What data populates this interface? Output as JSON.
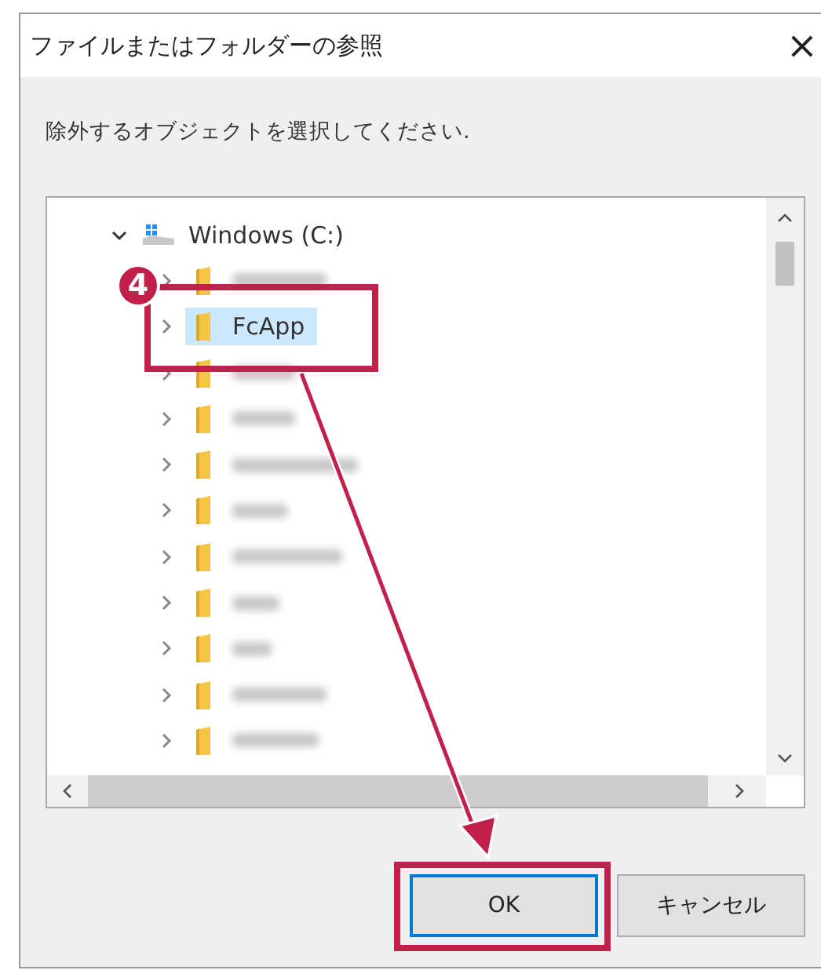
{
  "window": {
    "title": "ファイルまたはフォルダーの参照",
    "close": "×"
  },
  "instruction": "除外するオブジェクトを選択してください.",
  "tree": {
    "root": {
      "label": "Windows (C:)",
      "expanded": true,
      "children": [
        {
          "kind": "blurred",
          "selected": false
        },
        {
          "kind": "named",
          "label": "FcApp",
          "selected": true
        },
        {
          "kind": "blurred",
          "selected": false
        },
        {
          "kind": "blurred",
          "selected": false
        },
        {
          "kind": "blurred",
          "selected": false
        },
        {
          "kind": "blurred",
          "selected": false
        },
        {
          "kind": "blurred",
          "selected": false
        },
        {
          "kind": "blurred",
          "selected": false
        },
        {
          "kind": "blurred",
          "selected": false
        },
        {
          "kind": "blurred",
          "selected": false
        },
        {
          "kind": "blurred",
          "selected": false
        }
      ]
    }
  },
  "buttons": [
    {
      "label": "OK",
      "default": true
    },
    {
      "label": "キャンセル",
      "default": false
    }
  ],
  "annotation": {
    "step": "4"
  }
}
